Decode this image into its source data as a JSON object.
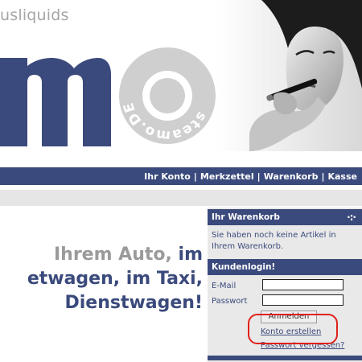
{
  "header": {
    "tagline": "usliquids",
    "brand_letter": "m",
    "seal_text": "steamo.DE · ego ·",
    "photo_icon": "woman-with-e-cigarette-photo"
  },
  "nav": {
    "account": "Ihr Konto",
    "wishlist": "Merkzettel",
    "cart": "Warenkorb",
    "checkout": "Kasse",
    "separator": "|"
  },
  "headline": {
    "line1_gray": "Ihrem Auto,",
    "line1_blue": " im",
    "line2": "etwagen, im Taxi,",
    "line3": "Dienstwagen!"
  },
  "sidebar": {
    "cart": {
      "title": "Ihr Warenkorb",
      "menu_icon": "dots-icon",
      "message": "Sie haben noch keine Artikel in Ihrem Warenkorb."
    },
    "login": {
      "title": "Kundenlogin!",
      "email_label": "E-Mail",
      "password_label": "Passwort",
      "email_value": "",
      "password_value": "",
      "submit_label": "Anmelden",
      "create_account": "Konto erstellen",
      "forgot_password": "Passwort vergessen?"
    }
  },
  "colors": {
    "brand_blue": "#3b4a7c",
    "highlight_red": "#e0201a",
    "muted_gray": "#9a9a9a"
  }
}
